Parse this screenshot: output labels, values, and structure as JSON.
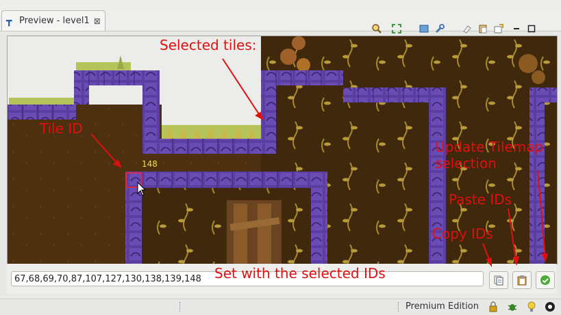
{
  "window": {
    "tab_title": "Preview - level1",
    "tab_close": "⊠"
  },
  "toolbar": {
    "icons": [
      "zoom-icon",
      "fit-icon",
      "screen-icon",
      "wrench-icon",
      "eraser-icon",
      "paste-icon",
      "export-icon",
      "minimize-icon",
      "maximize-icon"
    ]
  },
  "map": {
    "tile_id_label": "148"
  },
  "selection": {
    "ids_value": "67,68,69,70,87,107,127,130,138,139,148"
  },
  "annotations": {
    "selected_tiles": "Selected tiles:",
    "tile_id": "Tile ID",
    "update_tilemap": "Update Tilemap\nselection",
    "update_tilemap_line1": "Update Tilemap",
    "update_tilemap_line2": "selection",
    "paste_ids": "Paste IDs",
    "copy_ids": "Copy IDs",
    "set_with": "Set with the selected IDs"
  },
  "statusbar": {
    "edition": "Premium Edition"
  },
  "colors": {
    "annotation": "#e01010",
    "dirt": "#4a2f0f",
    "wall": "#5b3fa0",
    "grass": "#b5c45a"
  }
}
